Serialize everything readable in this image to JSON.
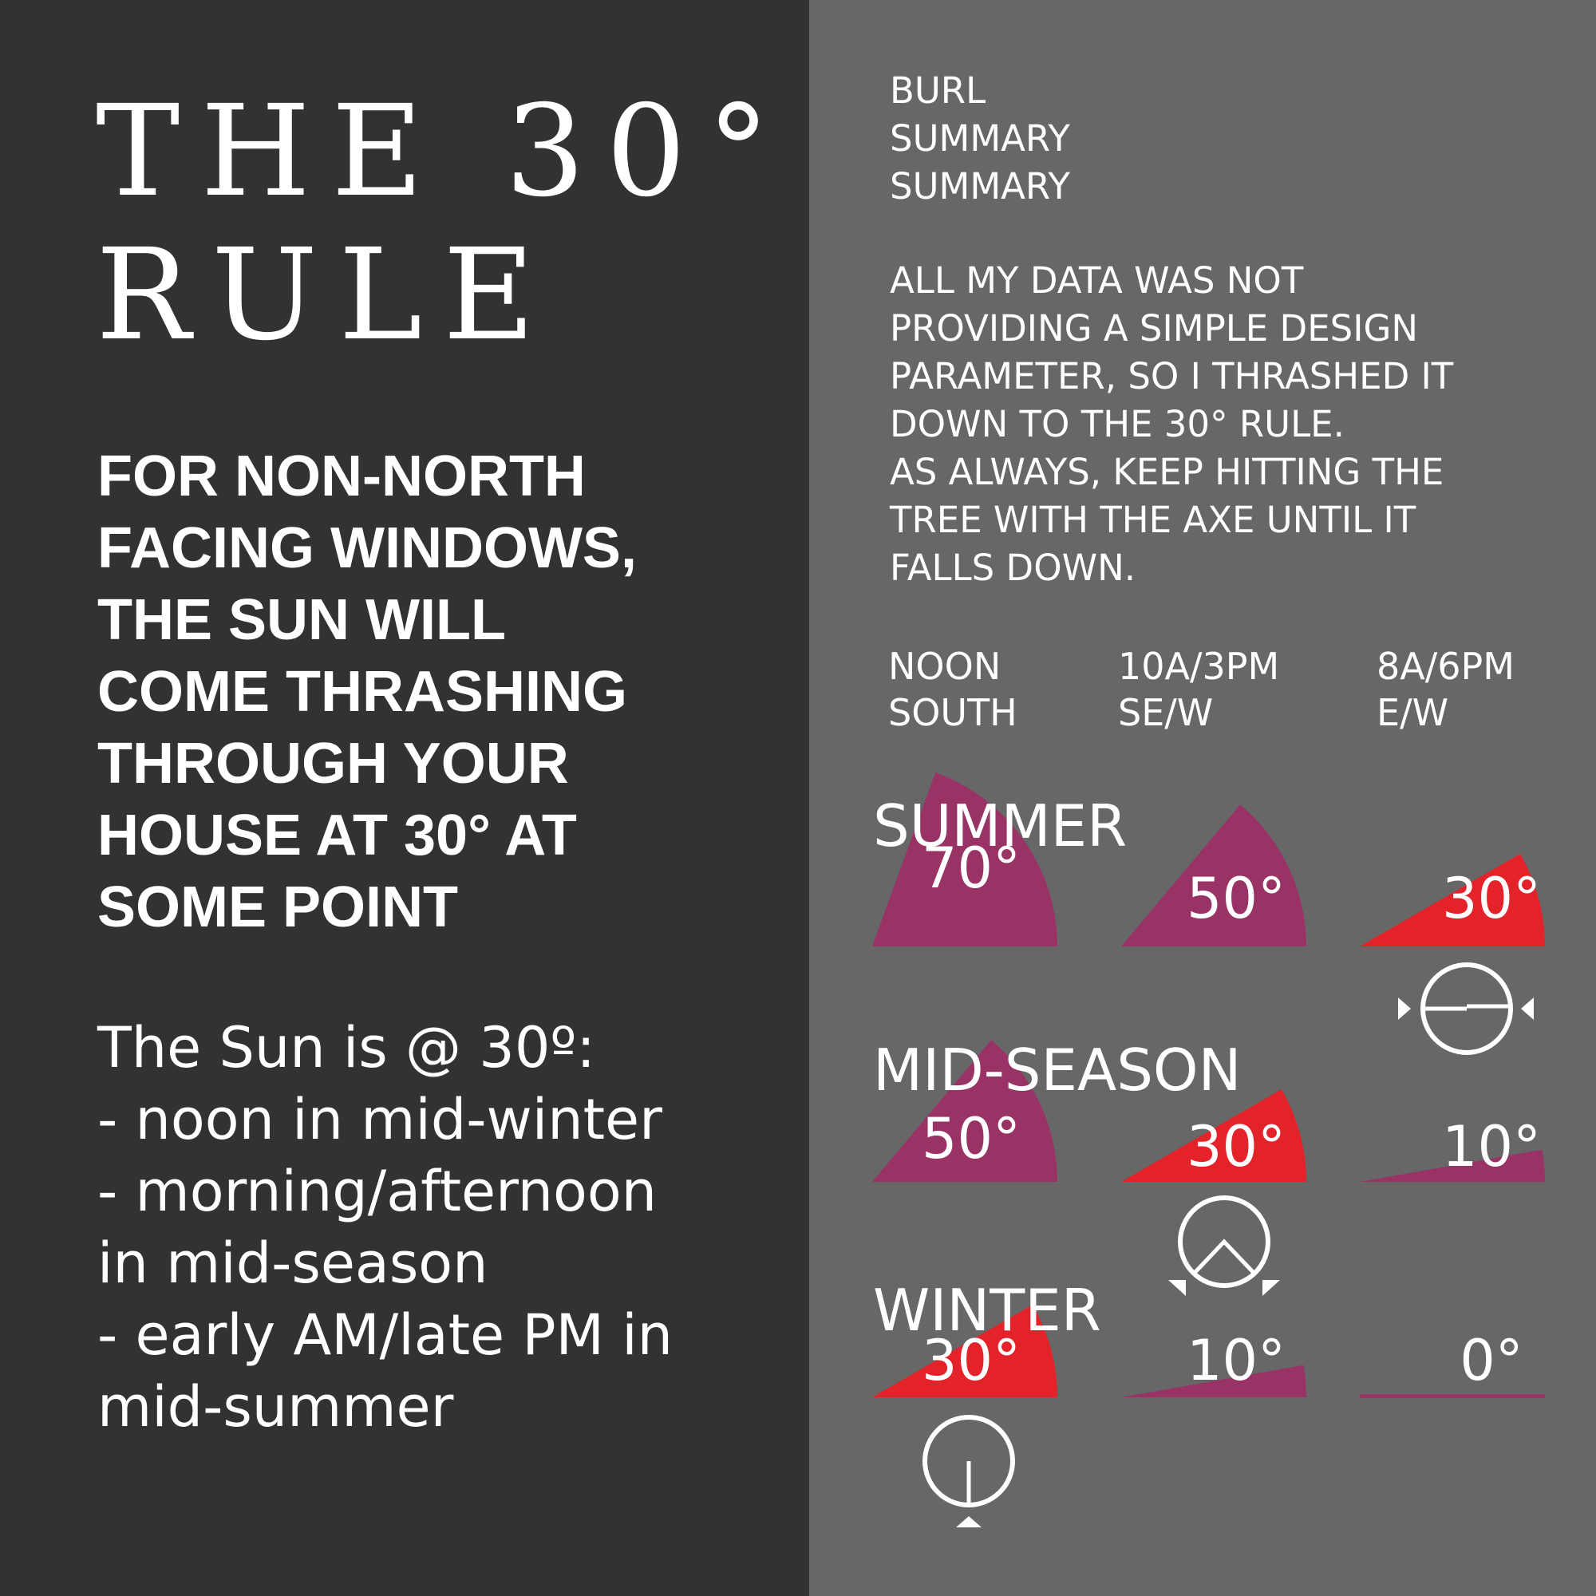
{
  "left_panel": {
    "title_lines": [
      "THE 30°",
      "RULE"
    ],
    "rule_lines": [
      "FOR NON-NORTH",
      "FACING WINDOWS,",
      "THE SUN WILL",
      "COME THRASHING",
      "THROUGH YOUR",
      "HOUSE AT 30° AT",
      "SOME POINT"
    ],
    "sun_lines": [
      "The Sun is @ 30º:",
      "- noon in mid-winter",
      "- morning/afternoon",
      "in mid-season",
      "- early AM/late PM in",
      "mid-summer"
    ]
  },
  "right_panel": {
    "header_lines": [
      "BURL",
      "SUMMARY",
      "SUMMARY"
    ],
    "summary_lines": [
      "ALL MY DATA WAS NOT",
      "PROVIDING A SIMPLE DESIGN",
      "PARAMETER, SO I THRASHED IT",
      "DOWN TO THE 30° RULE.",
      "AS ALWAYS, KEEP HITTING THE",
      "TREE WITH THE AXE UNTIL IT",
      "FALLS DOWN."
    ],
    "columns": [
      {
        "time": "NOON",
        "direction": "SOUTH"
      },
      {
        "time": "10A/3PM",
        "direction": "SE/W"
      },
      {
        "time": "8A/6PM",
        "direction": "E/W"
      }
    ],
    "seasons": [
      {
        "name": "SUMMER",
        "angles": [
          70,
          50,
          30
        ],
        "labels": [
          "70°",
          "50°",
          "30°"
        ]
      },
      {
        "name": "MID-SEASON",
        "angles": [
          50,
          30,
          10
        ],
        "labels": [
          "50°",
          "30°",
          "10°"
        ]
      },
      {
        "name": "WINTER",
        "angles": [
          30,
          10,
          0
        ],
        "labels": [
          "30°",
          "10°",
          "0°"
        ]
      }
    ],
    "highlight_angle": 30,
    "colors": {
      "default_wedge": "#993366",
      "highlight_wedge": "#E42229",
      "text": "#FFFFFF"
    },
    "icons": [
      "sun-east-west-icon",
      "sun-southeast-icon",
      "sun-south-icon"
    ]
  }
}
